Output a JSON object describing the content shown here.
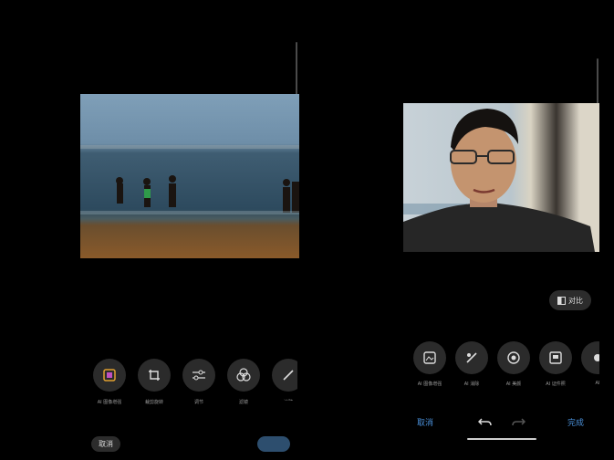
{
  "left": {
    "tools": [
      {
        "icon": "ai-image-icon",
        "label": "AI 图像增强"
      },
      {
        "icon": "crop-rotate-icon",
        "label": "裁剪旋转"
      },
      {
        "icon": "adjust-icon",
        "label": "调节"
      },
      {
        "icon": "filter-icon",
        "label": "滤镜"
      },
      {
        "icon": "brush-icon",
        "label": "涂鸦"
      }
    ],
    "cancel_label": "取消",
    "save_label": ""
  },
  "right": {
    "compare_label": "对比",
    "tools": [
      {
        "icon": "ai-image-icon",
        "label": "AI 图像增强"
      },
      {
        "icon": "ai-retouch-icon",
        "label": "AI 消除"
      },
      {
        "icon": "ai-beauty-icon",
        "label": "AI 美颜"
      },
      {
        "icon": "ai-id-photo-icon",
        "label": "AI 证件照"
      },
      {
        "icon": "more-tool-icon",
        "label": "AI"
      }
    ],
    "cancel_label": "取消",
    "undo_icon": "undo-icon",
    "redo_icon": "redo-icon",
    "done_label": "完成"
  }
}
